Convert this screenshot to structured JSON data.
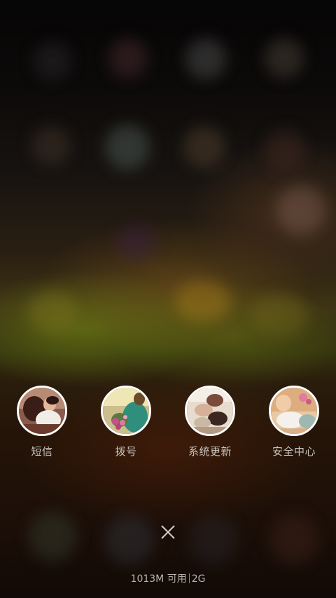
{
  "wallpaper": {
    "description_colors": [
      "#060505",
      "#3e3414",
      "#241408"
    ]
  },
  "recent_apps": [
    {
      "label": "短信",
      "icon": "sms-app-icon"
    },
    {
      "label": "拨号",
      "icon": "dialer-app-icon"
    },
    {
      "label": "系统更新",
      "icon": "system-update-app-icon"
    },
    {
      "label": "安全中心",
      "icon": "security-center-app-icon"
    }
  ],
  "close_button": {
    "icon": "close-icon"
  },
  "memory_status": {
    "available": "1013M 可用",
    "total": "2G"
  }
}
